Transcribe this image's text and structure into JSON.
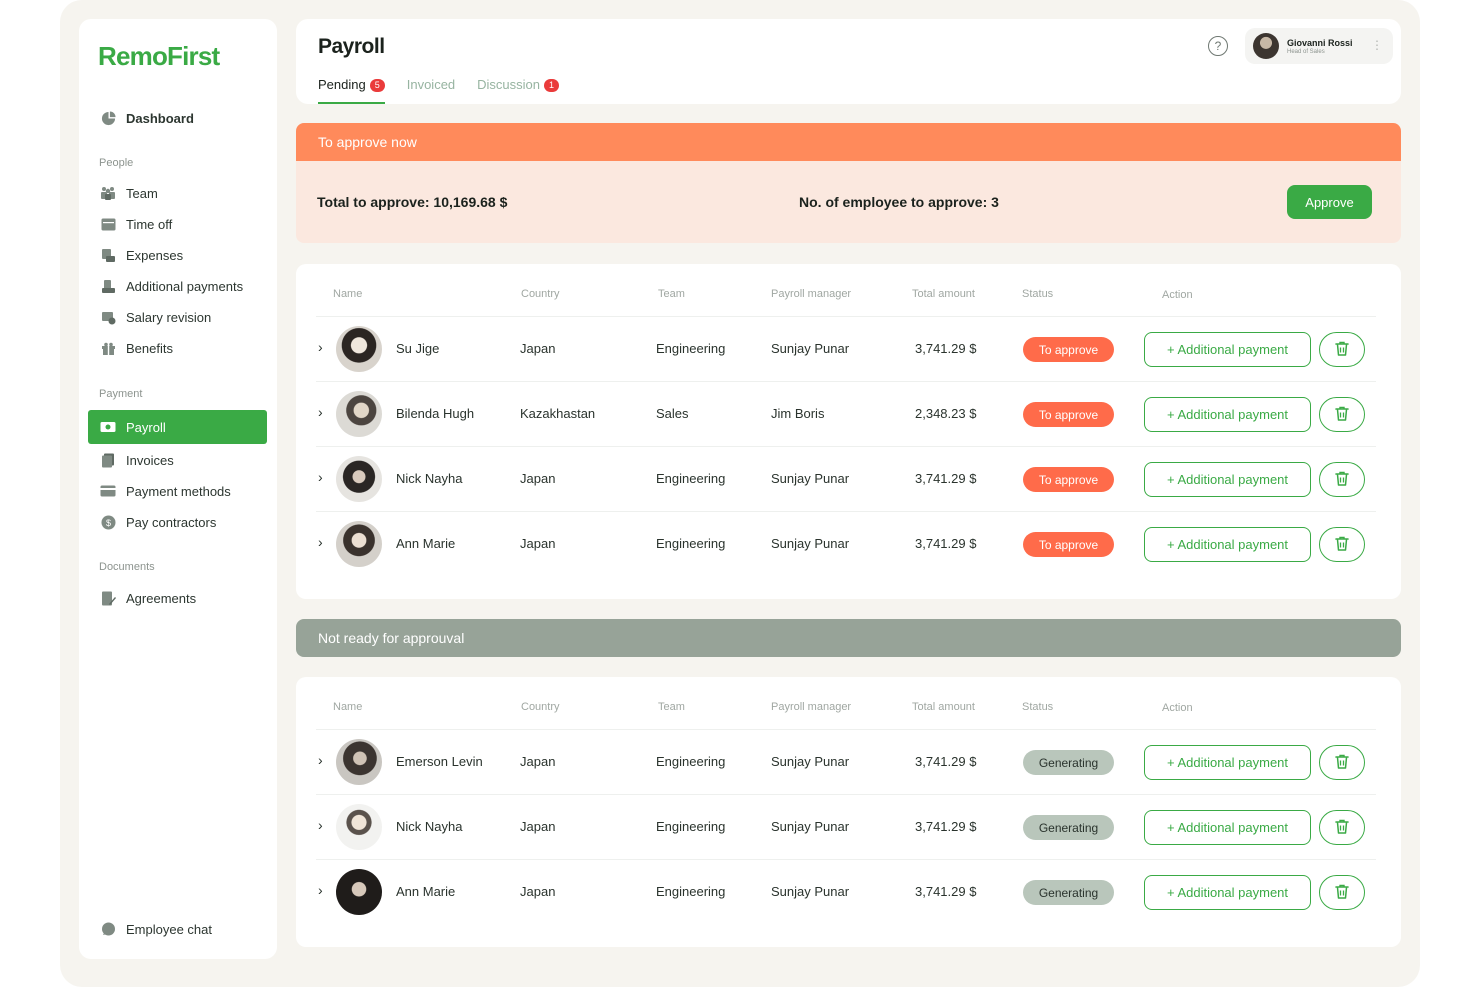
{
  "brand": {
    "logo": "RemoFirst",
    "accent": "#3aaa45"
  },
  "sidebar": {
    "dashboard": "Dashboard",
    "sections": {
      "people": "People",
      "payment": "Payment",
      "documents": "Documents"
    },
    "people_items": [
      "Team",
      "Time off",
      "Expenses",
      "Additional payments",
      "Salary revision",
      "Benefits"
    ],
    "payment_items": [
      "Payroll",
      "Invoices",
      "Payment methods",
      "Pay contractors"
    ],
    "documents_items": [
      "Agreements"
    ],
    "footer": "Employee chat",
    "active": "Payroll"
  },
  "header": {
    "title": "Payroll",
    "tabs": [
      {
        "label": "Pending",
        "badge": "5",
        "active": true
      },
      {
        "label": "Invoiced",
        "badge": "",
        "active": false
      },
      {
        "label": "Discussion",
        "badge": "1",
        "active": false
      }
    ],
    "help": "?",
    "user": {
      "name": "Giovanni Rossi",
      "role": "Head of Sales",
      "more": "⋮"
    }
  },
  "approve_section": {
    "title": "To approve now",
    "total": "Total to approve: 10,169.68 $",
    "count": "No. of employee to approve: 3",
    "button": "Approve"
  },
  "table_columns": [
    "Name",
    "Country",
    "Team",
    "Payroll manager",
    "Total amount",
    "Status",
    "Action"
  ],
  "action_label": "+ Additional payment",
  "pending_rows": [
    {
      "name": "Su Jige",
      "country": "Japan",
      "team": "Engineering",
      "manager": "Sunjay Punar",
      "amount": "3,741.29 $",
      "status": "To approve"
    },
    {
      "name": "Bilenda Hugh",
      "country": "Kazakhastan",
      "team": "Sales",
      "manager": "Jim Boris",
      "amount": "2,348.23 $",
      "status": "To approve"
    },
    {
      "name": "Nick Nayha",
      "country": "Japan",
      "team": "Engineering",
      "manager": "Sunjay Punar",
      "amount": "3,741.29 $",
      "status": "To approve"
    },
    {
      "name": "Ann Marie",
      "country": "Japan",
      "team": "Engineering",
      "manager": "Sunjay Punar",
      "amount": "3,741.29 $",
      "status": "To approve"
    }
  ],
  "not_ready_section": {
    "title": "Not ready for approuval"
  },
  "not_ready_rows": [
    {
      "name": "Emerson Levin",
      "country": "Japan",
      "team": "Engineering",
      "manager": "Sunjay Punar",
      "amount": "3,741.29 $",
      "status": "Generating"
    },
    {
      "name": "Nick Nayha",
      "country": "Japan",
      "team": "Engineering",
      "manager": "Sunjay Punar",
      "amount": "3,741.29 $",
      "status": "Generating"
    },
    {
      "name": "Ann Marie",
      "country": "Japan",
      "team": "Engineering",
      "manager": "Sunjay Punar",
      "amount": "3,741.29 $",
      "status": "Generating"
    }
  ],
  "colors": {
    "approve_bar": "#ff8a5b",
    "status_to_approve": "#ff6b4a",
    "status_generating": "#b9c6bb",
    "not_ready_bar": "#97a398"
  }
}
